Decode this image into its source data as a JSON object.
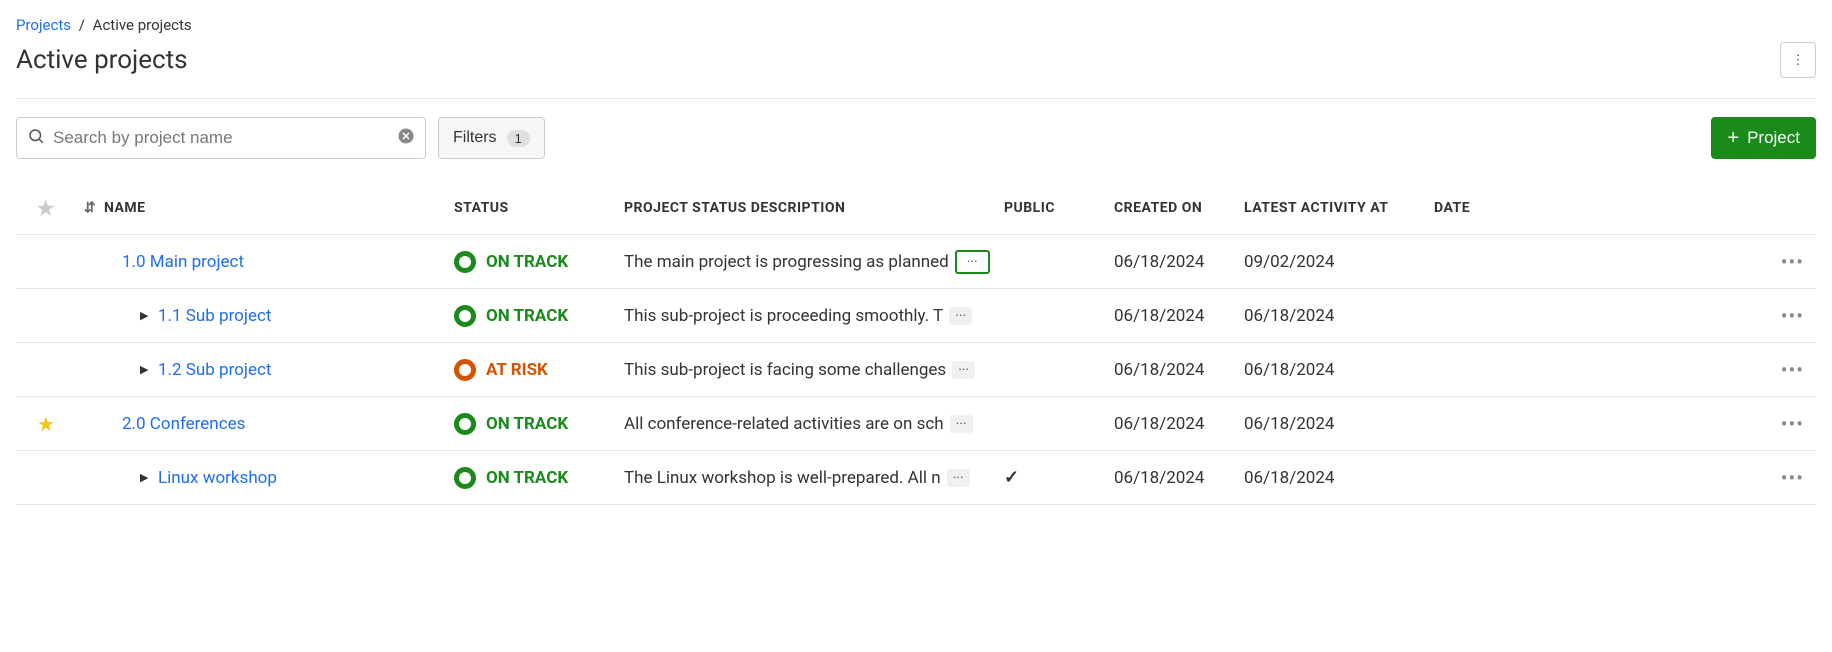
{
  "breadcrumb": {
    "root": "Projects",
    "current": "Active projects"
  },
  "page_title": "Active projects",
  "search": {
    "placeholder": "Search by project name",
    "value": ""
  },
  "filters": {
    "label": "Filters",
    "count": "1"
  },
  "primary_button": {
    "label": "Project"
  },
  "columns": {
    "name": "NAME",
    "status": "STATUS",
    "desc": "PROJECT STATUS DESCRIPTION",
    "public": "PUBLIC",
    "created": "CREATED ON",
    "latest": "LATEST ACTIVITY AT",
    "date": "DATE"
  },
  "rows": [
    {
      "favorite": false,
      "indent": 1,
      "expandable": false,
      "name": "1.0 Main project",
      "status_label": "ON TRACK",
      "status_kind": "on-track",
      "desc": "The main project is progressing as planned",
      "desc_highlight": true,
      "public": false,
      "created": "06/18/2024",
      "latest": "09/02/2024",
      "date": ""
    },
    {
      "favorite": false,
      "indent": 2,
      "expandable": true,
      "name": "1.1 Sub project",
      "status_label": "ON TRACK",
      "status_kind": "on-track",
      "desc": "This sub-project is proceeding smoothly. T",
      "desc_highlight": false,
      "public": false,
      "created": "06/18/2024",
      "latest": "06/18/2024",
      "date": ""
    },
    {
      "favorite": false,
      "indent": 2,
      "expandable": true,
      "name": "1.2 Sub project",
      "status_label": "AT RISK",
      "status_kind": "at-risk",
      "desc": "This sub-project is facing some challenges",
      "desc_highlight": false,
      "public": false,
      "created": "06/18/2024",
      "latest": "06/18/2024",
      "date": ""
    },
    {
      "favorite": true,
      "indent": 1,
      "expandable": false,
      "name": "2.0 Conferences",
      "status_label": "ON TRACK",
      "status_kind": "on-track",
      "desc": "All conference-related activities are on sch",
      "desc_highlight": false,
      "public": false,
      "created": "06/18/2024",
      "latest": "06/18/2024",
      "date": ""
    },
    {
      "favorite": false,
      "indent": 2,
      "expandable": true,
      "name": "Linux workshop",
      "status_label": "ON TRACK",
      "status_kind": "on-track",
      "desc": "The Linux workshop is well-prepared. All n",
      "desc_highlight": false,
      "public": true,
      "created": "06/18/2024",
      "latest": "06/18/2024",
      "date": ""
    }
  ]
}
